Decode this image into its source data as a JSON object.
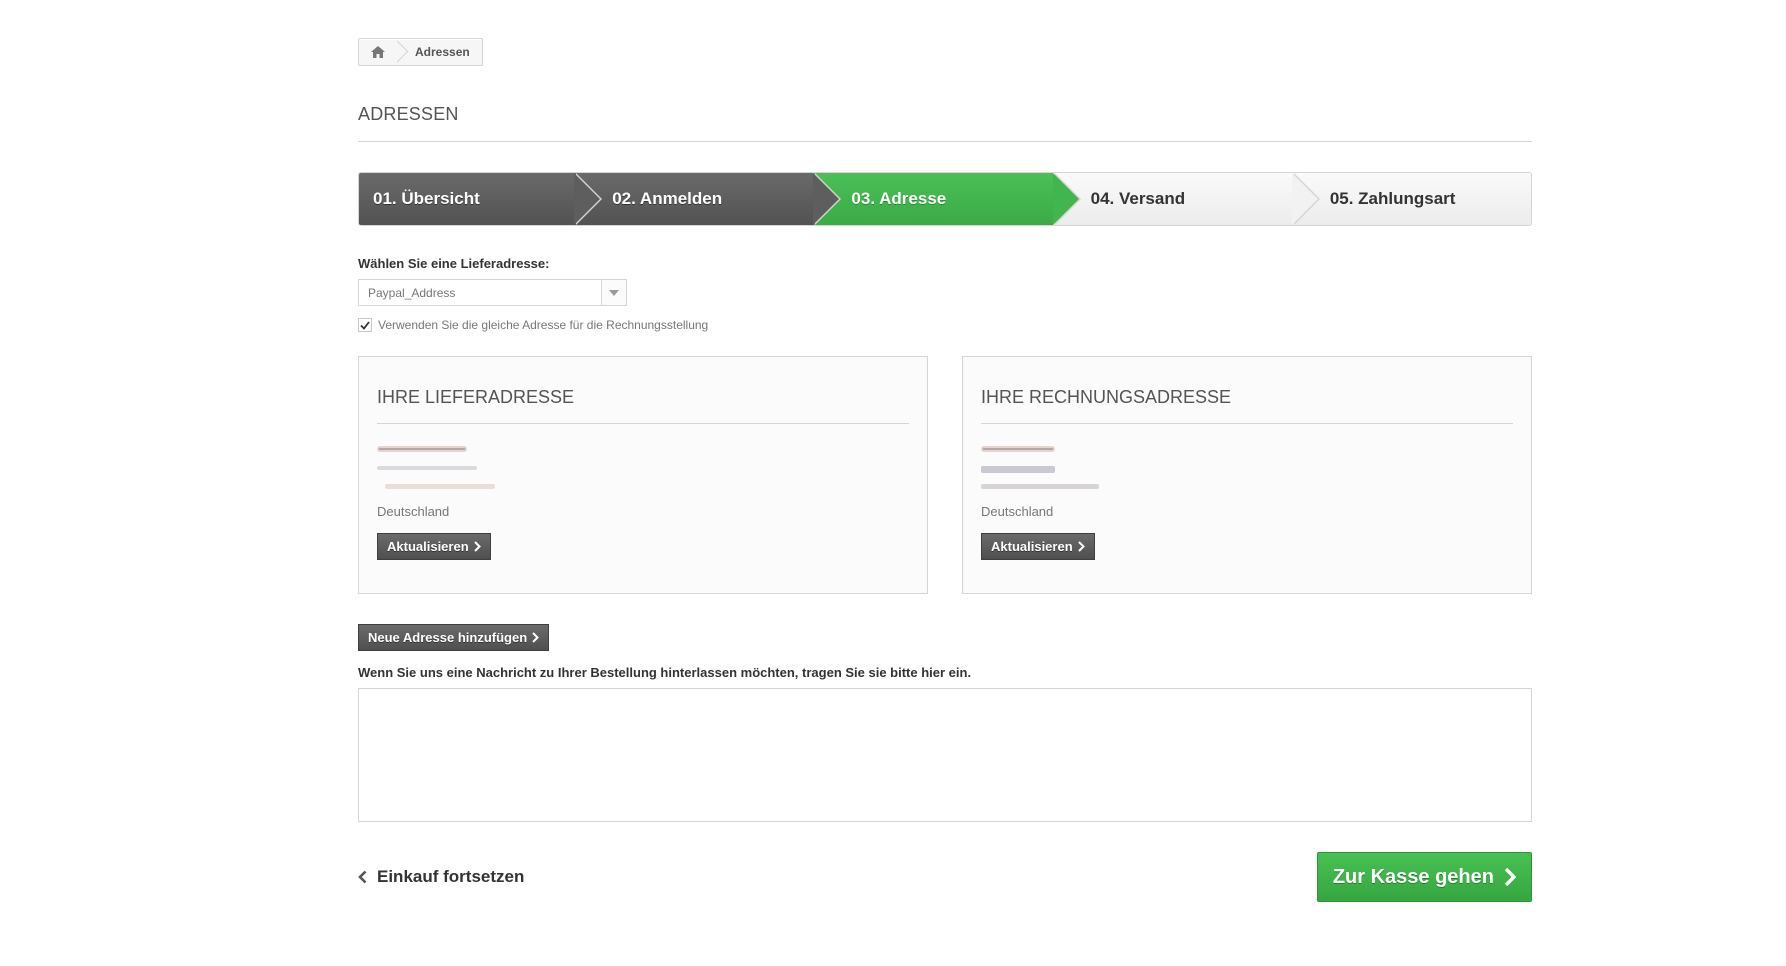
{
  "breadcrumb": {
    "home_icon": "home-icon",
    "current": "Adressen"
  },
  "page_heading": "ADRESSEN",
  "steps": [
    {
      "label": "01. Übersicht",
      "state": "done"
    },
    {
      "label": "02. Anmelden",
      "state": "done"
    },
    {
      "label": "03. Adresse",
      "state": "current"
    },
    {
      "label": "04. Versand",
      "state": "todo"
    },
    {
      "label": "05. Zahlungsart",
      "state": "todo"
    }
  ],
  "delivery_select": {
    "label": "Wählen Sie eine Lieferadresse:",
    "value": "Paypal_Address"
  },
  "same_address": {
    "checked": true,
    "label": "Verwenden Sie die gleiche Adresse für die Rechnungsstellung"
  },
  "delivery_address": {
    "title": "IHRE LIEFERADRESSE",
    "country": "Deutschland",
    "update_label": "Aktualisieren"
  },
  "billing_address": {
    "title": "IHRE RECHNUNGSADRESSE",
    "country": "Deutschland",
    "update_label": "Aktualisieren"
  },
  "new_address_label": "Neue Adresse hinzufügen",
  "message": {
    "label": "Wenn Sie uns eine Nachricht zu Ihrer Bestellung hinterlassen möchten, tragen Sie sie bitte hier ein.",
    "value": ""
  },
  "continue_shopping_label": "Einkauf fortsetzen",
  "checkout_label": "Zur Kasse gehen",
  "colors": {
    "accent_green": "#43b54e",
    "step_dark": "#5e5e5e",
    "border": "#d6d4d4"
  }
}
